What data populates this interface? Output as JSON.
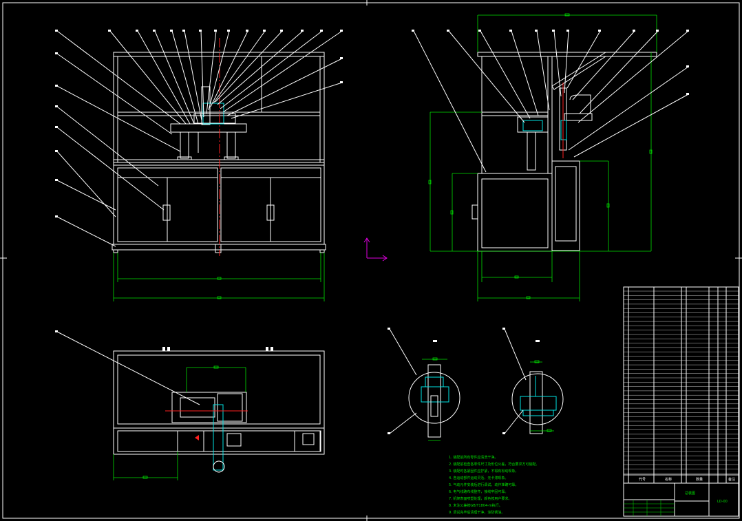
{
  "title_block": {
    "drawing_name": "总装图",
    "drawing_number": "LD-00",
    "col_headers": [
      "序号",
      "代号",
      "名称",
      "数量",
      "材料",
      "备注"
    ]
  },
  "tech_requirements": [
    "1. 装配前所有零件应清洗干净。",
    "2. 装配前检查各零件尺寸及形位公差，符合要求方可装配。",
    "3. 装配时各紧固件应拧紧，不得有松动现象。",
    "4. 各运动部件运动灵活，无卡滞现象。",
    "5. 气动元件安装后进行调试，动作准确可靠。",
    "6. 电气线路布线整齐，接线牢固可靠。",
    "7. 机架表面喷塑处理，颜色按用户要求。",
    "8. 未注公差按GB/T1804-m执行。",
    "9. 调试完毕后清理干净，涂防锈油。"
  ],
  "views": {
    "front": "front-view",
    "side": "side-view",
    "top": "top-view",
    "detail_a": "detail-a",
    "detail_b": "detail-b"
  },
  "colors": {
    "outline": "#ffffff",
    "dimension": "#00e000",
    "section": "#00e5e5",
    "centerline": "#ff2020",
    "ucs": "#e000e0"
  }
}
